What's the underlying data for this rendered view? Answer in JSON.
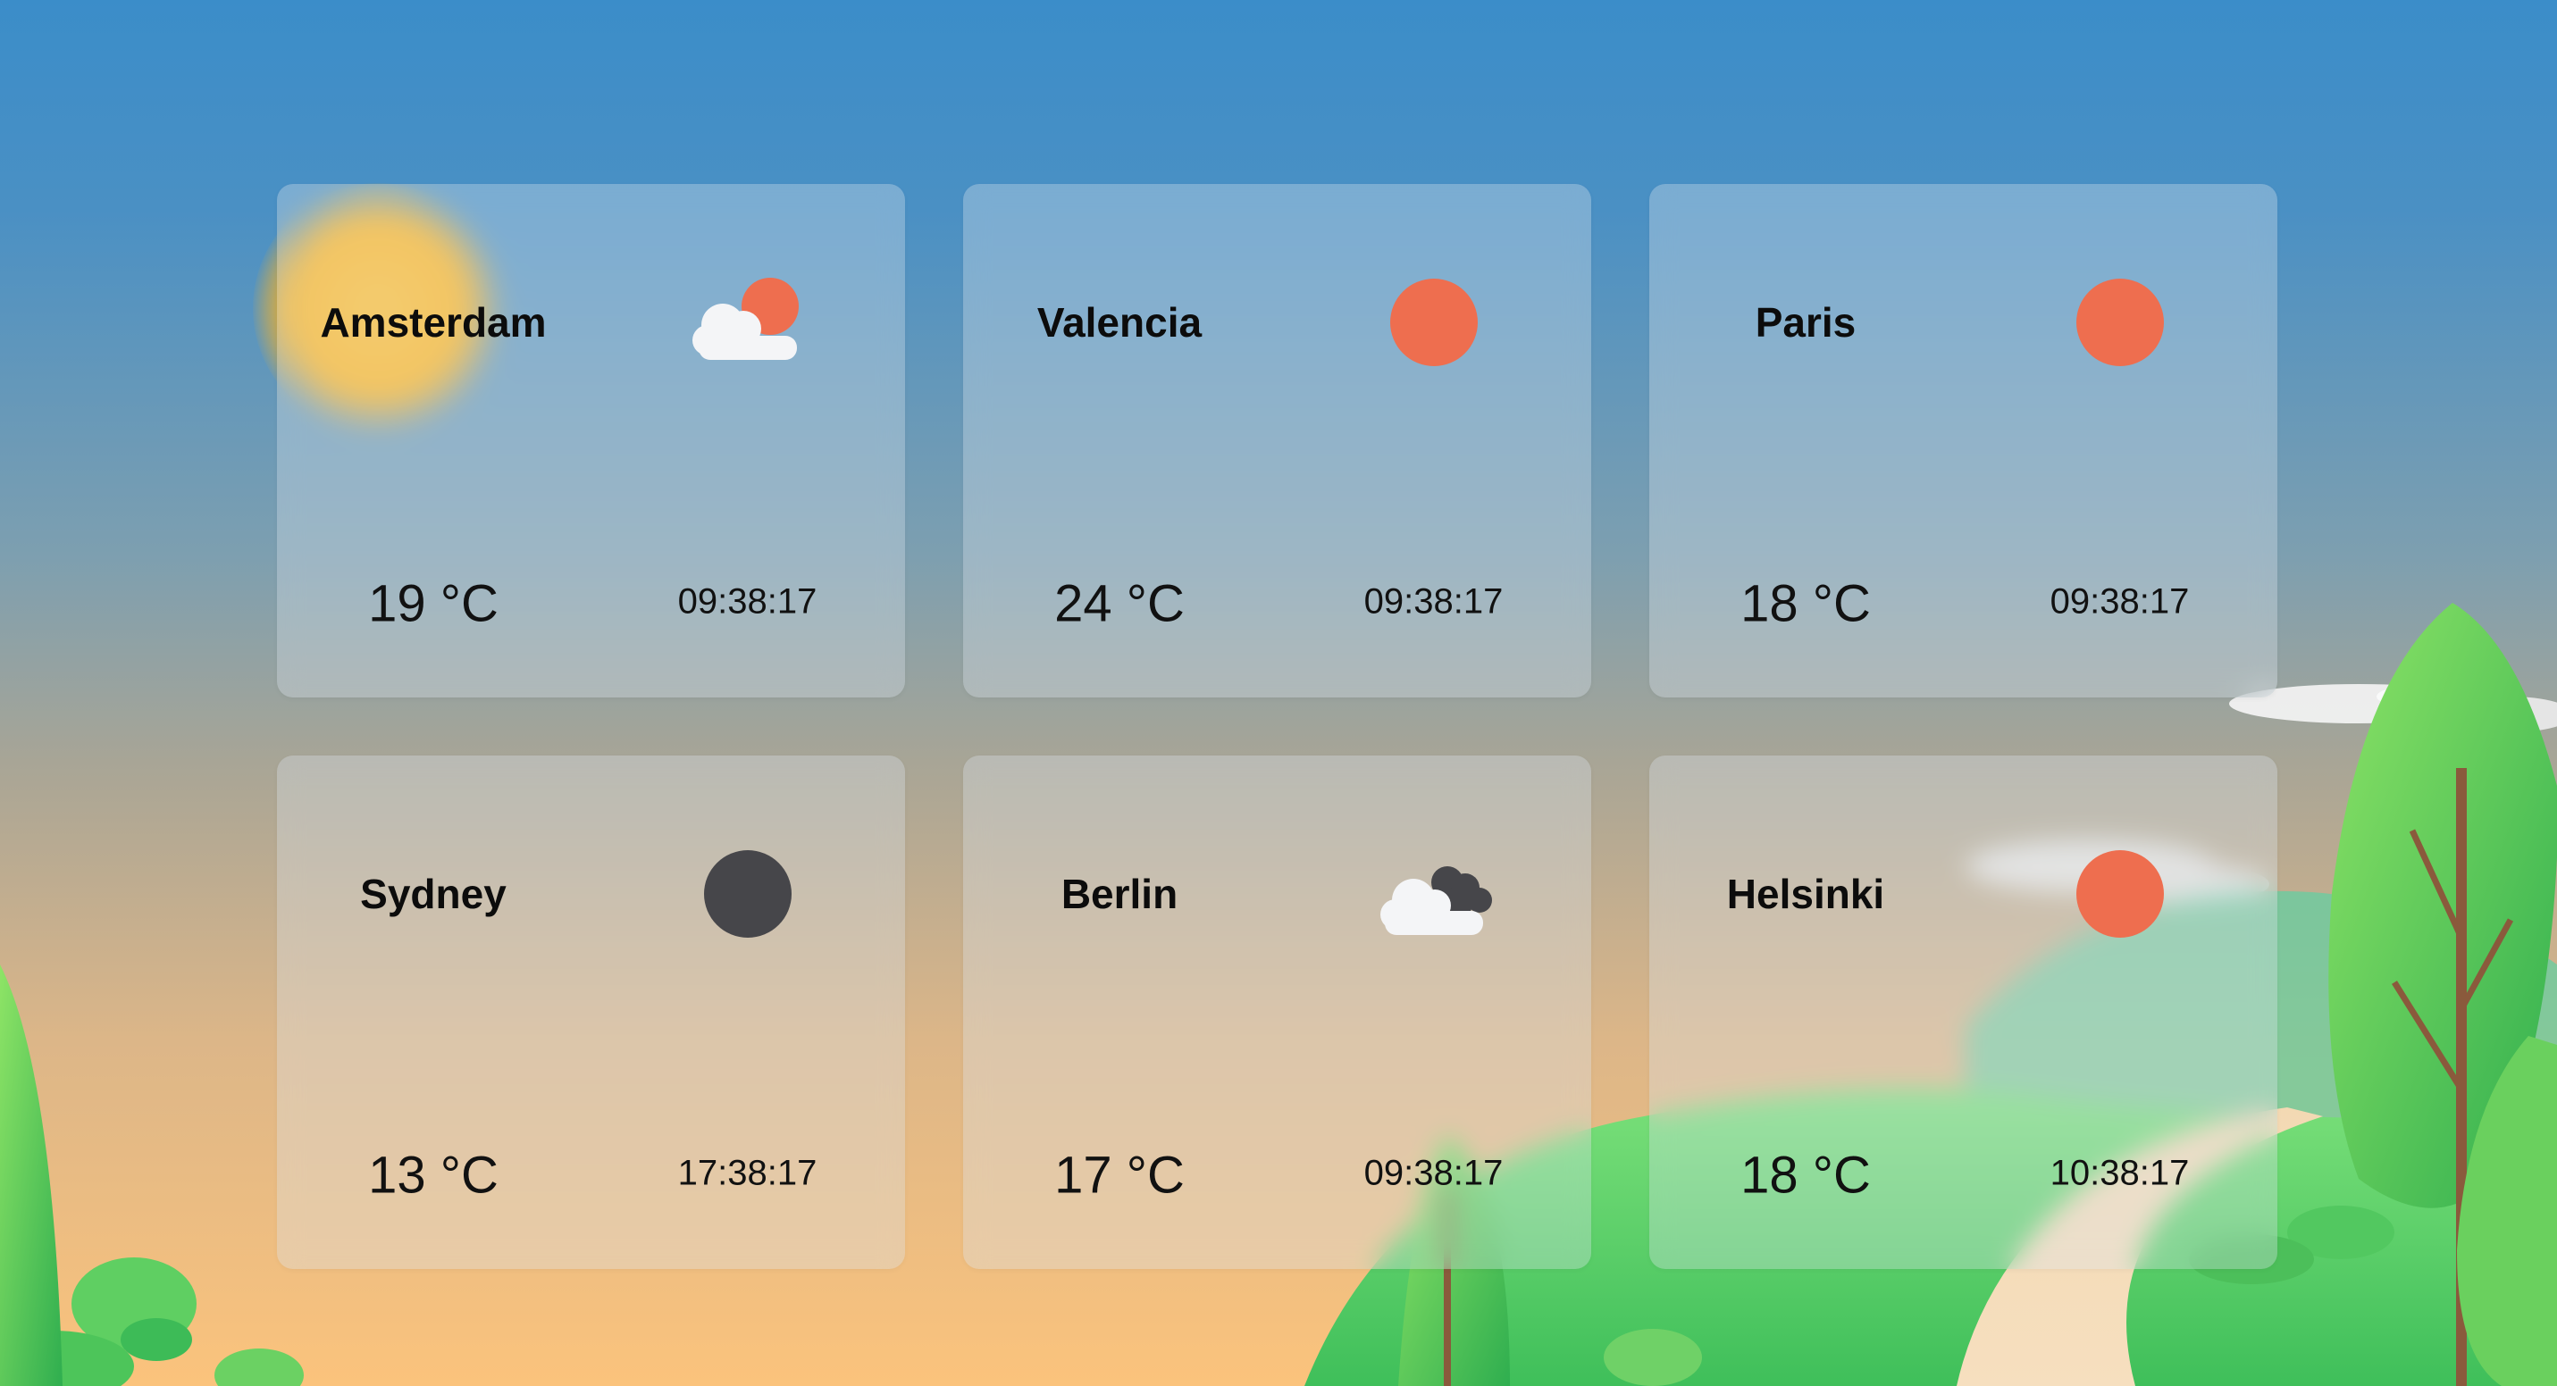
{
  "colors": {
    "sun": "#ee6e4f",
    "moon": "#46464a",
    "cloud": "#f4f5f7",
    "dark_cloud": "#46464a",
    "glow": "#ffb41a"
  },
  "cards": [
    {
      "city": "Amsterdam",
      "temp": "19 °C",
      "time": "09:38:17",
      "icon": "partly-cloudy-icon"
    },
    {
      "city": "Valencia",
      "temp": "24 °C",
      "time": "09:38:17",
      "icon": "sun-icon"
    },
    {
      "city": "Paris",
      "temp": "18 °C",
      "time": "09:38:17",
      "icon": "sun-icon"
    },
    {
      "city": "Sydney",
      "temp": "13 °C",
      "time": "17:38:17",
      "icon": "moon-icon"
    },
    {
      "city": "Berlin",
      "temp": "17 °C",
      "time": "09:38:17",
      "icon": "cloudy-night-icon"
    },
    {
      "city": "Helsinki",
      "temp": "18 °C",
      "time": "10:38:17",
      "icon": "sun-icon"
    }
  ]
}
